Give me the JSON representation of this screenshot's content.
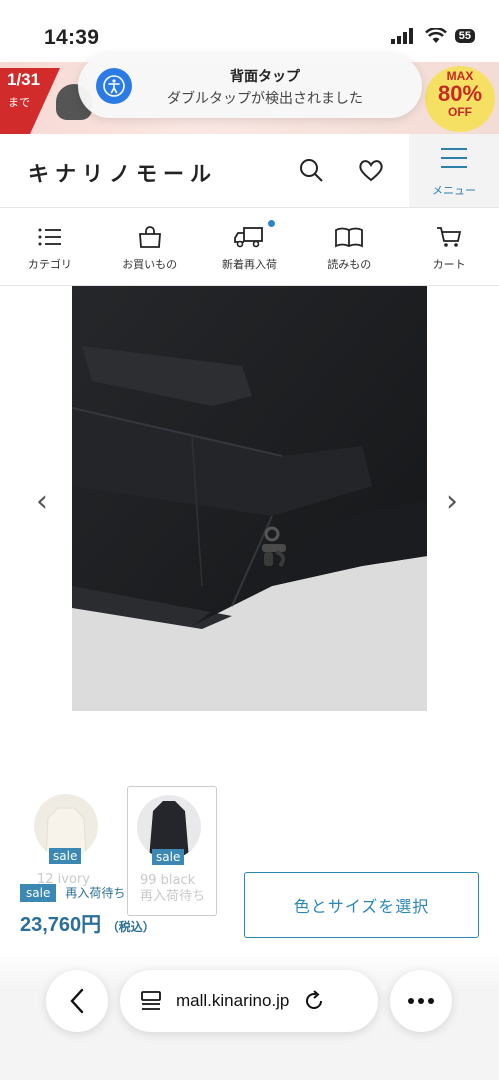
{
  "status_bar": {
    "time": "14:39",
    "battery": "55"
  },
  "promo": {
    "date": "1/31",
    "date_sub": "まで",
    "max_label": "MAX",
    "max_value": "80%",
    "max_off": "OFF"
  },
  "toast": {
    "title": "背面タップ",
    "message": "ダブルタップが検出されました"
  },
  "header": {
    "logo": "キナリノモール",
    "menu_label": "メニュー"
  },
  "nav": [
    {
      "label": "カテゴリ",
      "icon": "list-icon"
    },
    {
      "label": "お買いもの",
      "icon": "shopping-bag-icon"
    },
    {
      "label": "新着再入荷",
      "icon": "delivery-truck-icon"
    },
    {
      "label": "読みもの",
      "icon": "book-icon"
    },
    {
      "label": "カート",
      "icon": "cart-icon"
    }
  ],
  "thumbnails": [
    {
      "badge": "sale",
      "caption_line1": "12 ivory",
      "caption_line2": ""
    },
    {
      "badge": "sale",
      "caption_line1": "99 black",
      "caption_line2": "再入荷待ち"
    }
  ],
  "product": {
    "sale_badge": "sale",
    "restock_label": "再入荷待ち",
    "price": "23,760円",
    "tax_note": "（税込）",
    "select_button": "色とサイズを選択"
  },
  "browser": {
    "url": "mall.kinarino.jp"
  },
  "colors": {
    "accent": "#2b86b8",
    "sale": "#3b88b5",
    "promo_red": "#d12b2b"
  }
}
